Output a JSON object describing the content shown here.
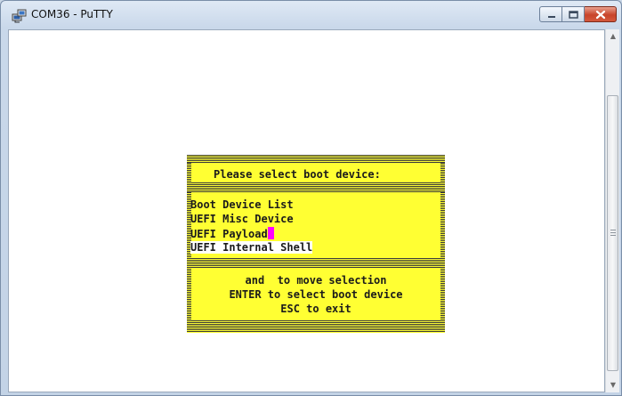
{
  "window": {
    "title": "COM36 - PuTTY",
    "icon": "putty-computer-icon"
  },
  "controls": {
    "minimize_icon": "minimize-icon",
    "maximize_icon": "maximize-icon",
    "close_icon": "close-icon"
  },
  "menu": {
    "heading": "Please select boot device:",
    "items": [
      "Boot Device List",
      "UEFI Misc Device",
      "UEFI Payload",
      "UEFI Internal Shell"
    ],
    "selected_index": 3,
    "help": [
      "and  to move selection",
      "ENTER to select boot device",
      "ESC to exit"
    ],
    "colors": {
      "background": "#ffff33",
      "text": "#1b1b1b",
      "cursor": "#ff00ff",
      "selection": "#ffffff"
    }
  },
  "scrollbar": {
    "up_arrow": "▲",
    "down_arrow": "▼"
  }
}
